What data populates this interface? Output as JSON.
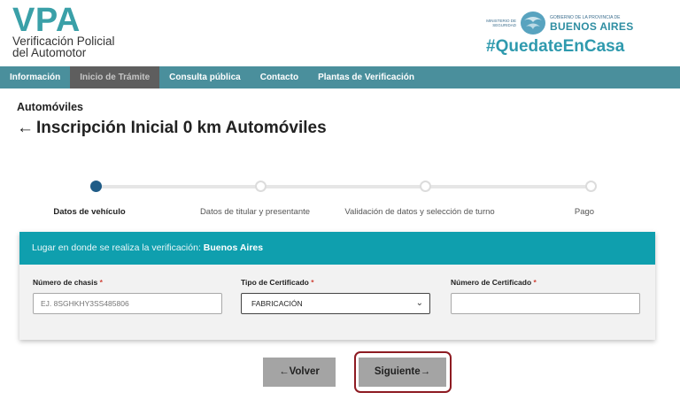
{
  "header": {
    "logo": "VPA",
    "logo_sub_line1": "Verificación Policial",
    "logo_sub_line2": "del Automotor",
    "gov_ministry": "MINISTERIO DE SEGURIDAD",
    "gov_province": "GOBIERNO DE LA PROVINCIA DE",
    "gov_name": "BUENOS AIRES",
    "hashtag": "#QuedateEnCasa"
  },
  "nav": {
    "items": [
      {
        "label": "Información",
        "active": false
      },
      {
        "label": "Inicio de Trámite",
        "active": true
      },
      {
        "label": "Consulta pública",
        "active": false
      },
      {
        "label": "Contacto",
        "active": false
      },
      {
        "label": "Plantas de Verificación",
        "active": false
      }
    ]
  },
  "page": {
    "section": "Automóviles",
    "back_arrow": "←",
    "title": "Inscripción Inicial 0 km Automóviles"
  },
  "stepper": {
    "steps": [
      {
        "label": "Datos de vehículo",
        "active": true
      },
      {
        "label": "Datos de titular y presentante",
        "active": false
      },
      {
        "label": "Validación de datos y selección de turno",
        "active": false
      },
      {
        "label": "Pago",
        "active": false
      }
    ]
  },
  "panel": {
    "head_text": "Lugar en donde se realiza la verificación: ",
    "head_place": "Buenos Aires",
    "fields": {
      "chasis_label": "Número de chasis",
      "chasis_placeholder": "EJ. 8SGHKHY3SS485806",
      "chasis_value": "",
      "tipo_label": "Tipo de Certificado",
      "tipo_value": "FABRICACIÓN",
      "numero_label": "Número de Certificado",
      "numero_value": "",
      "required_mark": "*"
    }
  },
  "buttons": {
    "back": "←Volver",
    "next": "Siguiente→"
  },
  "colors": {
    "brand_teal": "#3aa0a8",
    "nav_bg": "#4a8f9c",
    "panel_head": "#0f9fae",
    "step_active": "#1f5c87",
    "highlight_border": "#8e1b22"
  }
}
